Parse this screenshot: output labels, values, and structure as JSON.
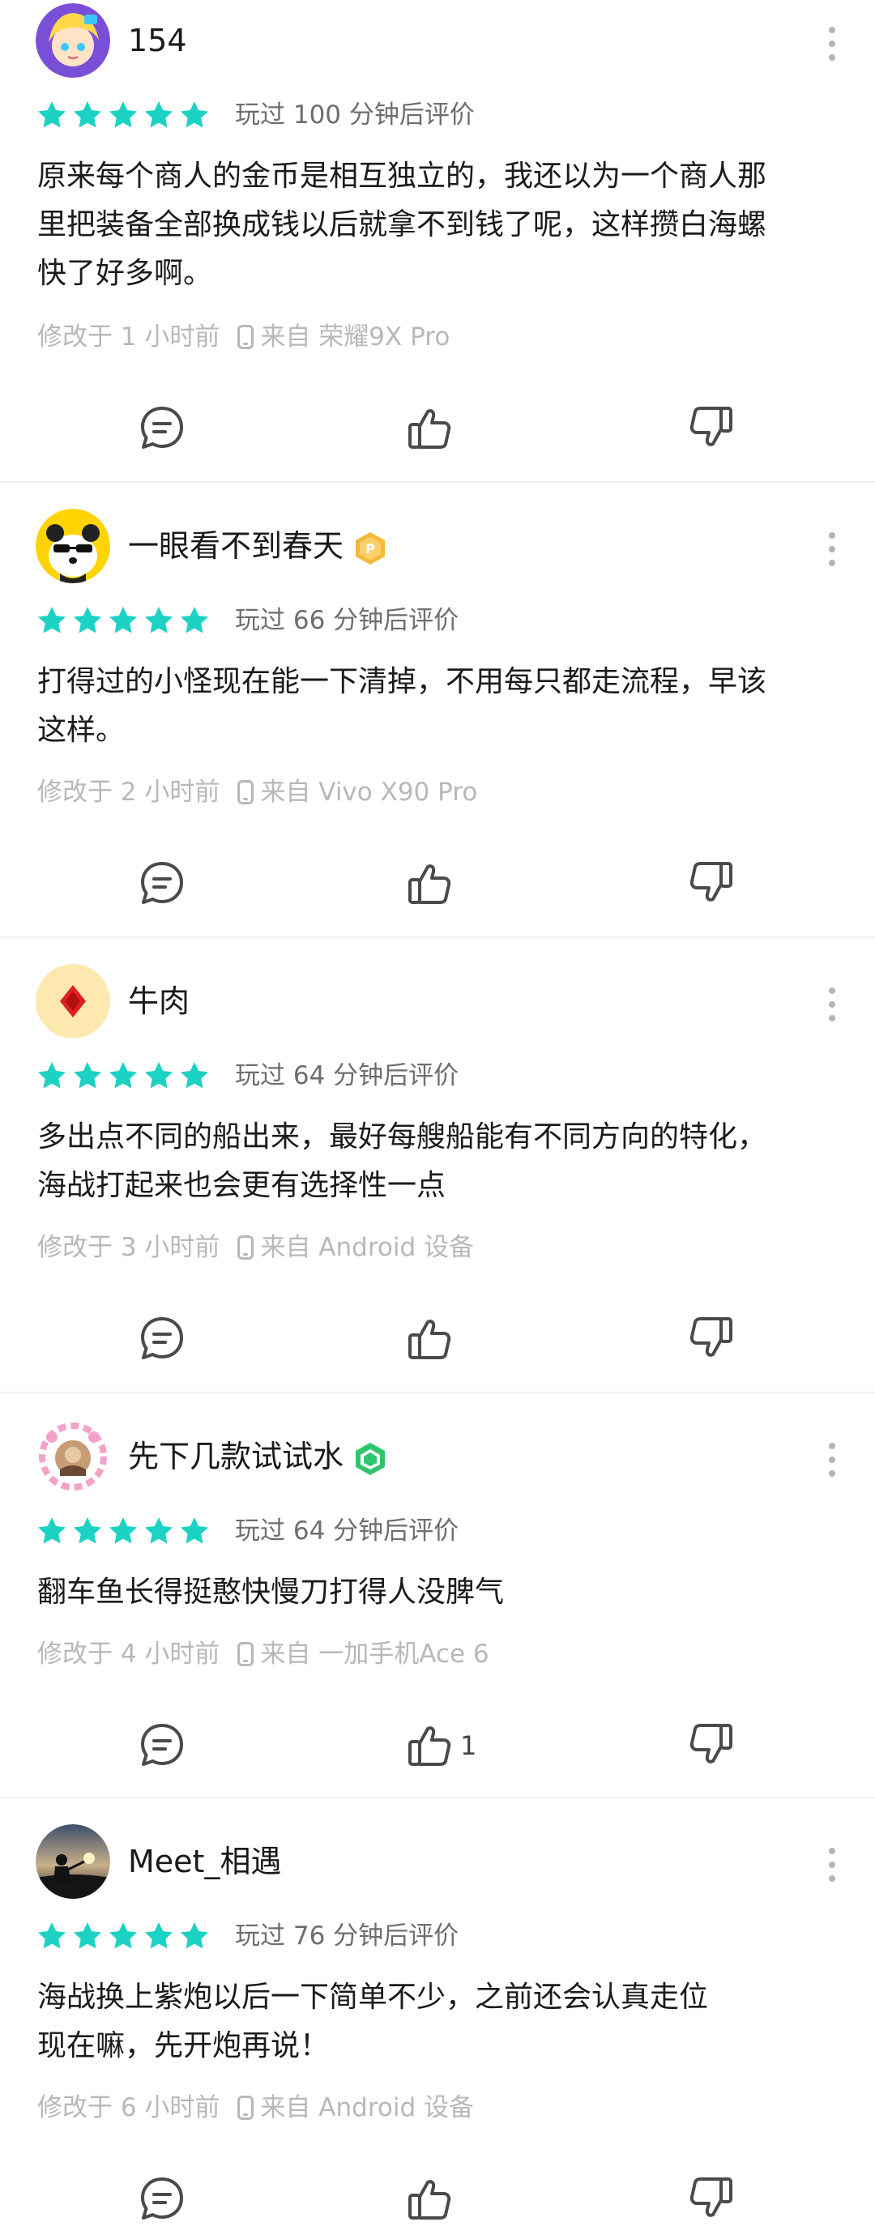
{
  "colors": {
    "star": "#1cd2c3",
    "icon": "#4a4a4a",
    "meta": "#b8b8b8"
  },
  "reviews": [
    {
      "user": "154",
      "avatar": "anime-girl-avatar",
      "badge": null,
      "rating": 5,
      "played": "玩过 100 分钟后评价",
      "lines": [
        "原来每个商人的金币是相互独立的，我还以为一个商人那",
        "里把装备全部换成钱以后就拿不到钱了呢，这样攒白海螺",
        "快了好多啊。"
      ],
      "edited": "修改于 1 小时前",
      "device": "来自 荣耀9X Pro",
      "likes": ""
    },
    {
      "user": "一眼看不到春天",
      "avatar": "panda-avatar",
      "badge": "gold-hexagon-badge",
      "rating": 5,
      "played": "玩过 66 分钟后评价",
      "lines": [
        "打得过的小怪现在能一下清掉，不用每只都走流程，早该",
        "这样。"
      ],
      "edited": "修改于 2 小时前",
      "device": "来自 Vivo X90 Pro",
      "likes": ""
    },
    {
      "user": "牛肉",
      "avatar": "diamond-card-avatar",
      "badge": null,
      "rating": 5,
      "played": "玩过 64 分钟后评价",
      "lines": [
        "多出点不同的船出来，最好每艘船能有不同方向的特化，",
        "海战打起来也会更有选择性一点"
      ],
      "edited": "修改于 3 小时前",
      "device": "来自 Android 设备",
      "likes": ""
    },
    {
      "user": "先下几款试试水",
      "avatar": "pink-frame-avatar",
      "badge": "green-hexagon-badge",
      "rating": 5,
      "played": "玩过 64 分钟后评价",
      "lines": [
        "翻车鱼长得挺憨快慢刀打得人没脾气"
      ],
      "edited": "修改于 4 小时前",
      "device": "来自 一加手机Ace 6",
      "likes": "1"
    },
    {
      "user": "Meet_相遇",
      "avatar": "sunset-silhouette-avatar",
      "badge": null,
      "rating": 5,
      "played": "玩过 76 分钟后评价",
      "lines": [
        "海战换上紫炮以后一下简单不少，之前还会认真走位",
        "现在嘛，先开炮再说！"
      ],
      "edited": "修改于 6 小时前",
      "device": "来自 Android 设备",
      "likes": ""
    }
  ]
}
